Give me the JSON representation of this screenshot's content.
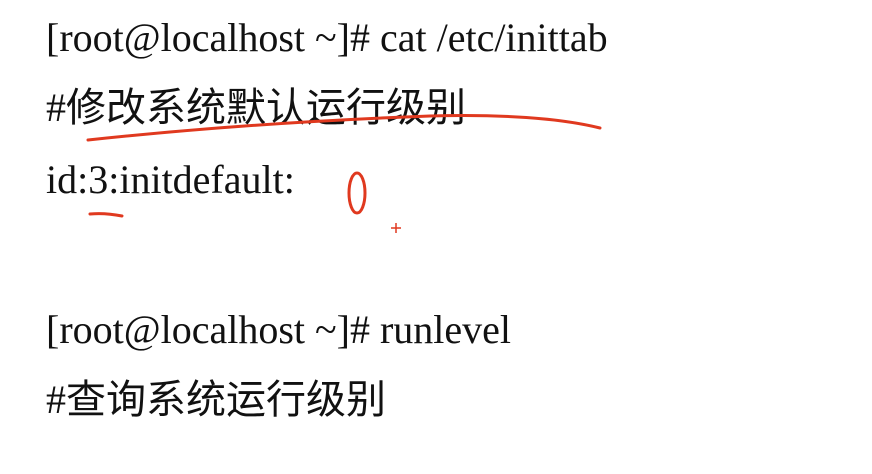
{
  "lines": {
    "cmd_cat": "[root@localhost ~]# cat /etc/inittab",
    "comment_modify": "#修改系统默认运行级别",
    "config": "id:3:initdefault:",
    "cmd_runlevel": "[root@localhost ~]# runlevel",
    "comment_query": "#查询系统运行级别"
  },
  "annotation_color": "#e0391f"
}
